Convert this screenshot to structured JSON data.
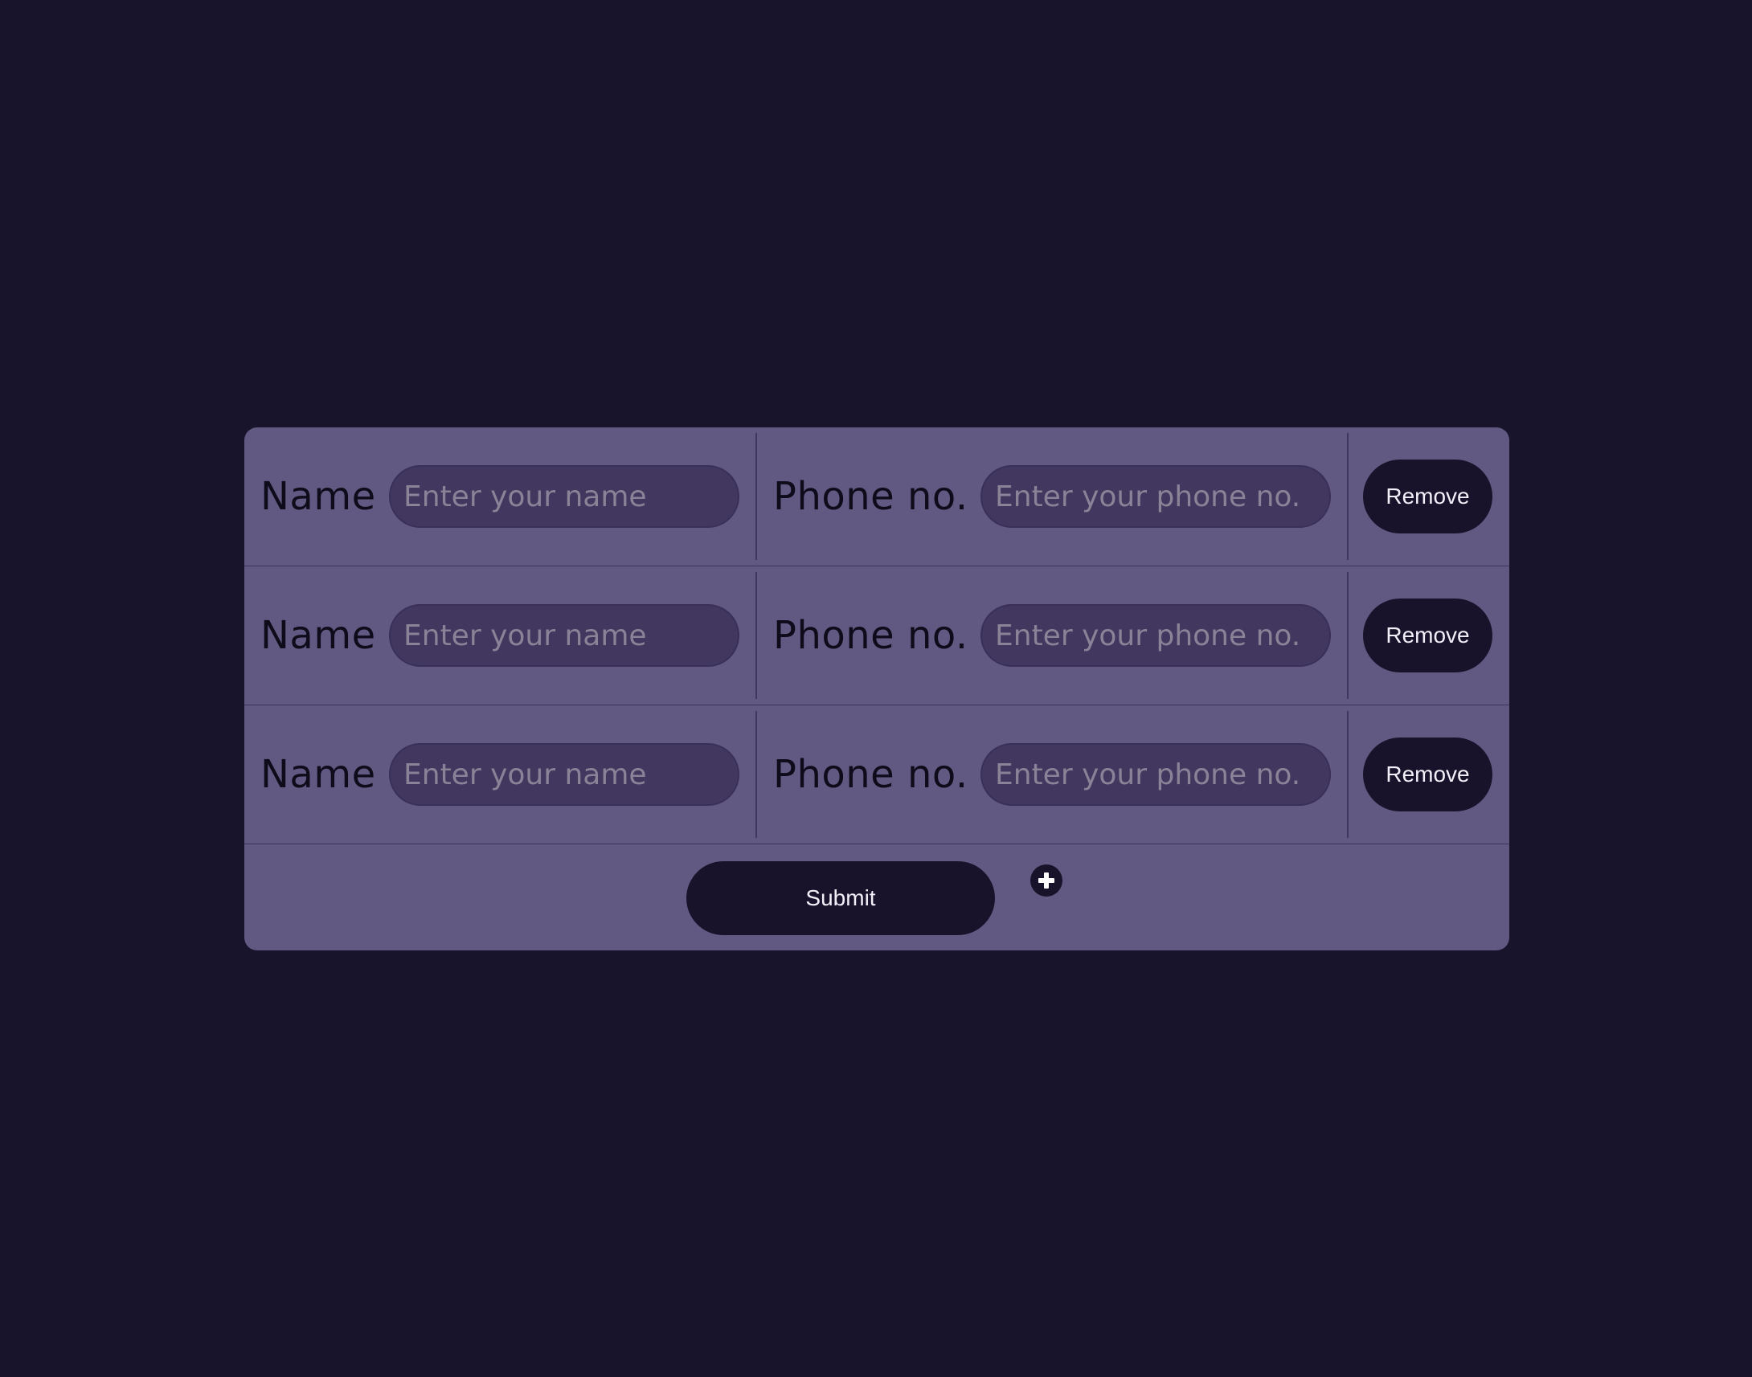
{
  "form": {
    "rows": [
      {
        "name_label": "Name",
        "name_placeholder": "Enter your name",
        "name_value": "",
        "phone_label": "Phone no.",
        "phone_placeholder": "Enter your phone no.",
        "phone_value": "",
        "remove_label": "Remove"
      },
      {
        "name_label": "Name",
        "name_placeholder": "Enter your name",
        "name_value": "",
        "phone_label": "Phone no.",
        "phone_placeholder": "Enter your phone no.",
        "phone_value": "",
        "remove_label": "Remove"
      },
      {
        "name_label": "Name",
        "name_placeholder": "Enter your name",
        "name_value": "",
        "phone_label": "Phone no.",
        "phone_placeholder": "Enter your phone no.",
        "phone_value": "",
        "remove_label": "Remove"
      }
    ],
    "submit_label": "Submit",
    "add_icon": "plus-icon"
  },
  "colors": {
    "page_background": "#18142b",
    "card_background": "#625982",
    "input_background": "#41375f",
    "button_background": "#18132b",
    "button_text": "#f2eff8",
    "label_text": "#0e0b1a",
    "placeholder_text": "#8a8296"
  }
}
